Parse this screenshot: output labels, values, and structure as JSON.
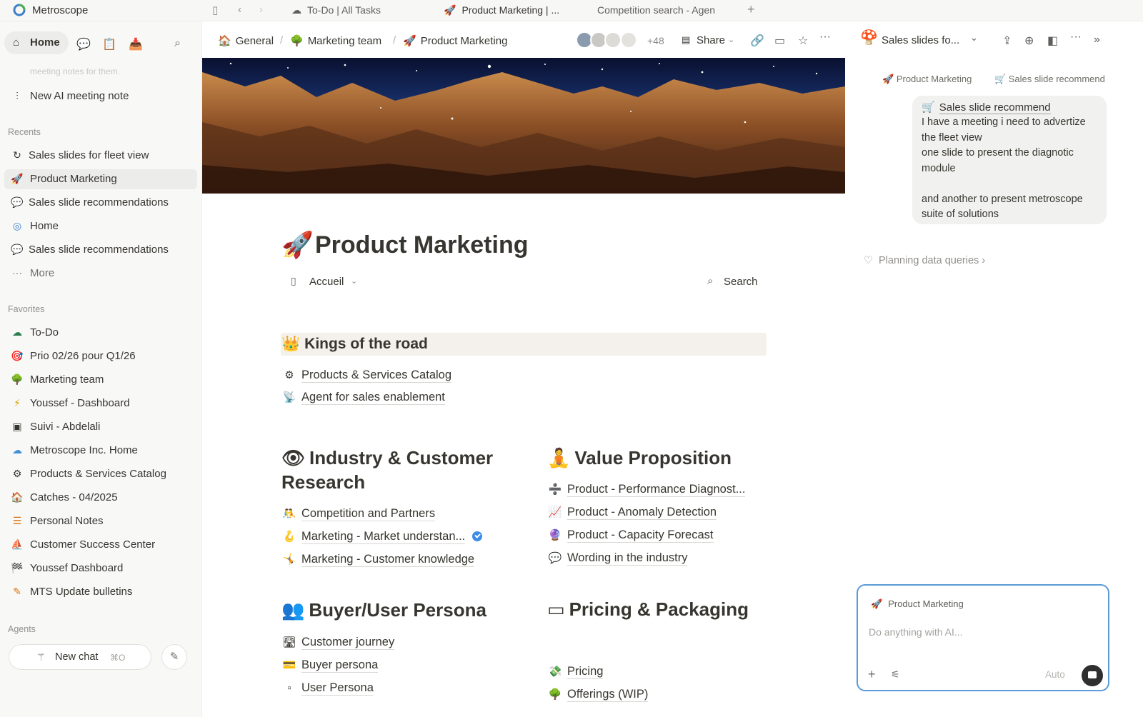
{
  "titlebar": {
    "app_name": "Metroscope",
    "tabs": [
      {
        "icon": "☁",
        "label": "To-Do | All Tasks"
      },
      {
        "icon": "🚀",
        "label": "Product Marketing | ..."
      },
      {
        "icon": "",
        "label": "Competition search - Agen"
      }
    ],
    "new_tab": "+"
  },
  "sidebar": {
    "home_label": "Home",
    "faded_top": "meeting notes for them.",
    "new_ai_note": "New AI meeting note",
    "recents_title": "Recents",
    "recents": [
      {
        "icon": "↻",
        "label": "Sales slides for fleet view"
      },
      {
        "icon": "🚀",
        "label": "Product Marketing"
      },
      {
        "icon": "💬",
        "label": "Sales slide recommendations"
      },
      {
        "icon": "◎",
        "label": "Home"
      },
      {
        "icon": "💬",
        "label": "Sales slide recommendations"
      },
      {
        "icon": "···",
        "label": "More"
      }
    ],
    "favorites_title": "Favorites",
    "favorites": [
      {
        "icon": "☁",
        "label": "To-Do"
      },
      {
        "icon": "🎯",
        "label": "Prio 02/26 pour Q1/26"
      },
      {
        "icon": "🌳",
        "label": "Marketing team"
      },
      {
        "icon": "⚡",
        "label": "Youssef - Dashboard"
      },
      {
        "icon": "▣",
        "label": "Suivi - Abdelali"
      },
      {
        "icon": "☁",
        "label": "Metroscope Inc. Home"
      },
      {
        "icon": "⚙",
        "label": "Products & Services Catalog"
      },
      {
        "icon": "🏠",
        "label": "Catches - 04/2025"
      },
      {
        "icon": "☰",
        "label": "Personal Notes"
      },
      {
        "icon": "⛵",
        "label": "Customer Success Center"
      },
      {
        "icon": "🏁",
        "label": "Youssef Dashboard"
      },
      {
        "icon": "✎",
        "label": "MTS Update bulletins"
      }
    ],
    "agents_title": "Agents",
    "new_chat": {
      "label": "New chat",
      "shortcut": "⌘O"
    }
  },
  "header": {
    "breadcrumb": [
      {
        "icon": "🏠",
        "label": "General"
      },
      {
        "icon": "🌳",
        "label": "Marketing team"
      },
      {
        "icon": "🚀",
        "label": "Product Marketing"
      }
    ],
    "separator": "/",
    "avatar_count": "+48",
    "share_label": "Share"
  },
  "page": {
    "icon": "🚀",
    "title": "Product Marketing",
    "view_label": "Accueil",
    "search_label": "Search",
    "sections": [
      {
        "icon": "👑",
        "title": "Kings of the road",
        "links": [
          {
            "icon": "⚙",
            "label": "Products & Services Catalog"
          },
          {
            "icon": "📡",
            "label": "Agent for sales enablement"
          }
        ]
      },
      {
        "icon": "👁",
        "title_line1": "Industry & Customer",
        "title_line2": "Research",
        "links": [
          {
            "icon": "🤼",
            "label": "Competition and Partners"
          },
          {
            "icon": "🪝",
            "label": "Marketing - Market understan..."
          },
          {
            "icon": "🤸",
            "label": "Marketing - Customer knowledge"
          }
        ]
      },
      {
        "icon": "🧘",
        "title": "Value Proposition",
        "links": [
          {
            "icon": "➗",
            "label": "Product - Performance Diagnost..."
          },
          {
            "icon": "📈",
            "label": "Product - Anomaly Detection"
          },
          {
            "icon": "🔮",
            "label": "Product - Capacity Forecast"
          },
          {
            "icon": "💬",
            "label": "Wording in the industry"
          }
        ]
      },
      {
        "icon": "👥",
        "title": "Buyer/User Persona",
        "links": [
          {
            "icon": "🛣",
            "label": "Customer journey"
          },
          {
            "icon": "💳",
            "label": "Buyer persona"
          },
          {
            "icon": "▫",
            "label": "User Persona"
          }
        ]
      },
      {
        "icon": "▭",
        "title": "Pricing & Packaging",
        "links": [
          {
            "icon": "💸",
            "label": "Pricing"
          },
          {
            "icon": "🌳",
            "label": "Offerings (WIP)"
          }
        ]
      }
    ]
  },
  "ai": {
    "title": "Sales slides fo...",
    "context_tags": [
      "Product Marketing",
      "Sales slide recommend"
    ],
    "message_title": "Sales slide recommend",
    "message_lines": [
      "I have a meeting i need to advertize",
      "the fleet view",
      "one slide to present the diagnotic",
      "module",
      "",
      "and another to present metroscope",
      "suite of solutions"
    ],
    "planning": "Planning data queries",
    "composer": {
      "context": "Product Marketing",
      "placeholder": "Do anything with AI...",
      "mode": "Auto"
    }
  },
  "colors": {
    "accent": "#5a9bd8",
    "sidebar_bg": "#f8f8f7",
    "section_bar": "#f4f1ec",
    "verified": "#3e8ce5"
  }
}
